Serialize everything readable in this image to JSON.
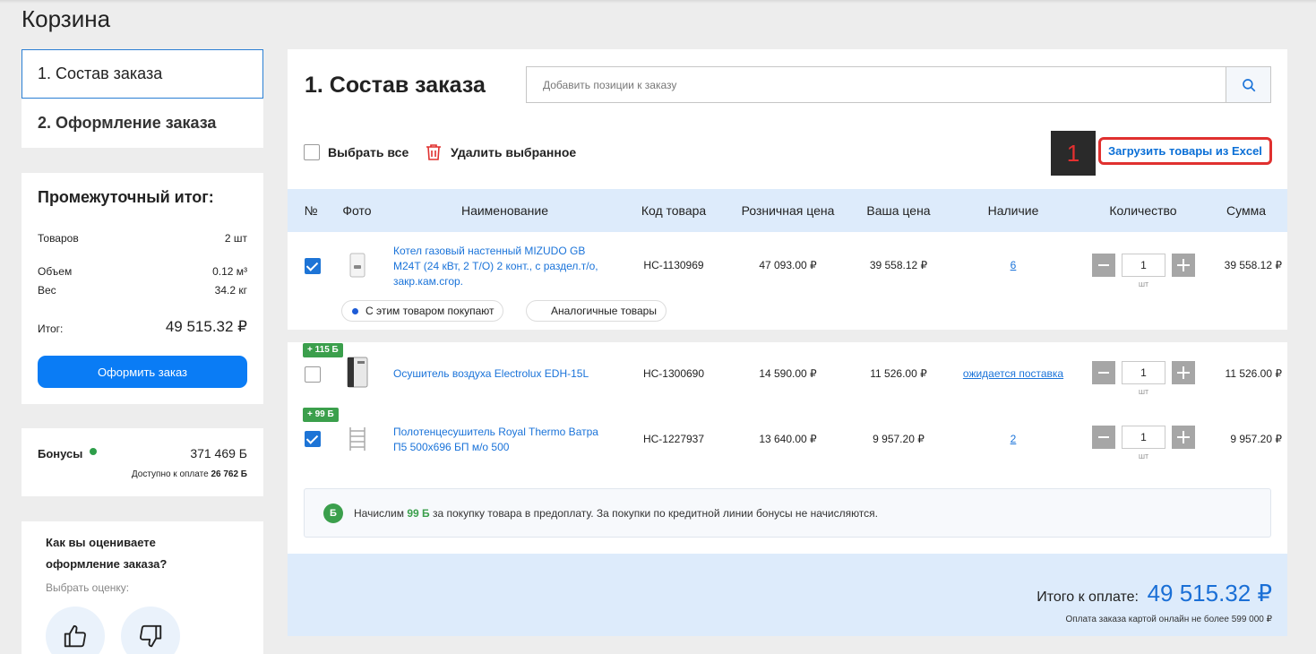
{
  "page": {
    "title": "Корзина"
  },
  "steps": [
    {
      "label": "1. Состав заказа"
    },
    {
      "label": "2. Оформление заказа"
    }
  ],
  "subtotal": {
    "title": "Промежуточный итог:",
    "goods_label": "Товаров",
    "goods_value": "2 шт",
    "volume_label": "Объем",
    "volume_value": "0.12 м³",
    "weight_label": "Вес",
    "weight_value": "34.2 кг",
    "total_label": "Итог:",
    "total_value": "49 515.32 ₽",
    "checkout_label": "Оформить заказ"
  },
  "bonus": {
    "label": "Бонусы",
    "value": "371 469 Б",
    "available_text": "Доступно к оплате",
    "available_value": "26 762 Б"
  },
  "rating": {
    "question": "Как вы оцениваете оформление заказа?",
    "subtitle": "Выбрать оценку:"
  },
  "main": {
    "title": "1. Состав заказа",
    "search_placeholder": "Добавить позиции к заказу",
    "select_all": "Выбрать все",
    "delete_selected": "Удалить выбранное",
    "annotation": "1",
    "excel_link": "Загрузить товары из Excel"
  },
  "table": {
    "headers": {
      "num": "№",
      "photo": "Фото",
      "name": "Наименование",
      "code": "Код товара",
      "retail": "Розничная цена",
      "price": "Ваша цена",
      "avail": "Наличие",
      "qty": "Количество",
      "sum": "Сумма"
    },
    "rows": [
      {
        "name": "Котел газовый настенный MIZUDO GB M24T (24 кВт, 2 Т/О) 2 конт., с раздел.т/о, закр.кам.сгор.",
        "code": "НС-1130969",
        "retail": "47 093.00 ₽",
        "price": "39 558.12 ₽",
        "avail": "6",
        "qty": "1",
        "unit": "шт",
        "sum": "39 558.12 ₽",
        "checked": true
      },
      {
        "bonus_tag": "+ 115 Б",
        "name": "Осушитель воздуха Electrolux EDH-15L",
        "code": "НС-1300690",
        "retail": "14 590.00 ₽",
        "price": "11 526.00 ₽",
        "avail": "ожидается поставка",
        "qty": "1",
        "unit": "шт",
        "sum": "11 526.00 ₽",
        "checked": false
      },
      {
        "bonus_tag": "+ 99 Б",
        "name": "Полотенцесушитель Royal Thermo Ватра П5 500х696 БП м/о 500",
        "code": "НС-1227937",
        "retail": "13 640.00 ₽",
        "price": "9 957.20 ₽",
        "avail": "2",
        "qty": "1",
        "unit": "шт",
        "sum": "9 957.20 ₽",
        "checked": true
      }
    ],
    "pills": [
      "С этим товаром покупают",
      "Аналогичные товары"
    ]
  },
  "notice": {
    "badge": "Б",
    "text_before": "Начислим",
    "amount": "99 Б",
    "text_after": "за покупку товара в предоплату. За покупки по кредитной линии бонусы не начисляются."
  },
  "footer": {
    "total_label": "Итого к оплате:",
    "total_value": "49 515.32 ₽",
    "note": "Оплата заказа картой онлайн не более 599 000 ₽"
  },
  "colors": {
    "accent": "#0a7cf5",
    "link": "#1a73d9",
    "bonus_green": "#3b9f4c",
    "header_bg": "#ddebfb",
    "highlight": "#e0302f"
  }
}
